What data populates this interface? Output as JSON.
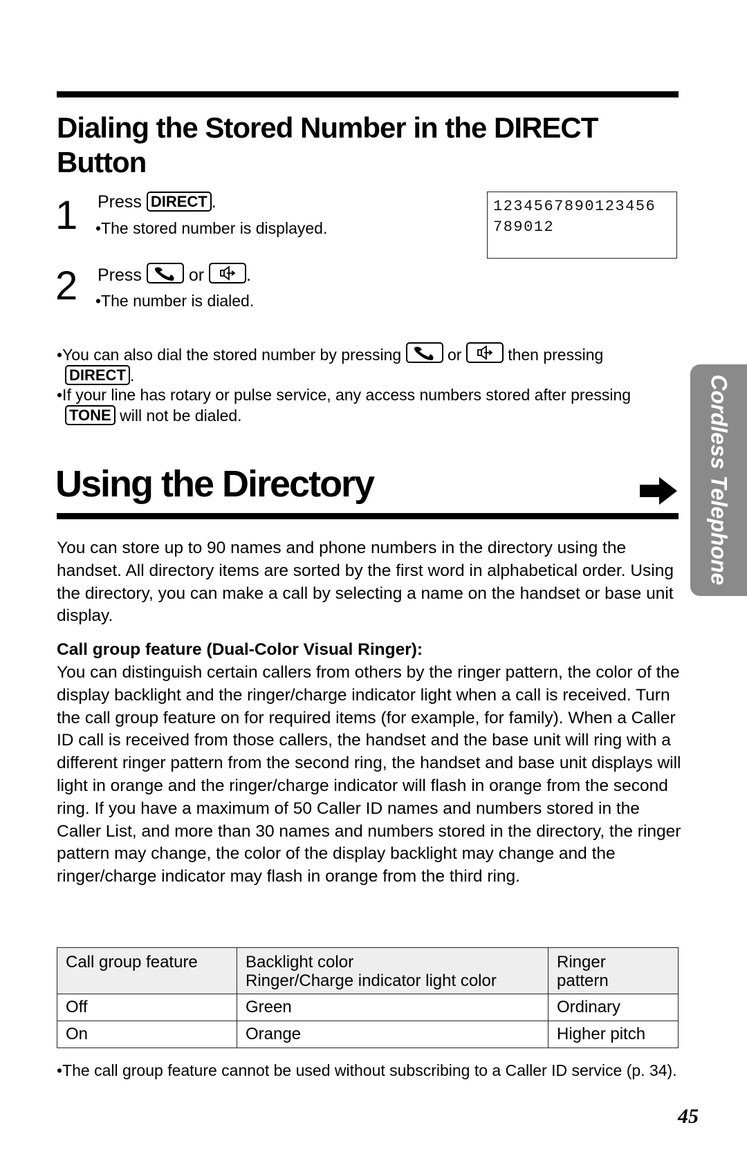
{
  "section1": {
    "title": "Dialing the Stored Number in the DIRECT Button",
    "steps": [
      {
        "number": "1",
        "press_label": "Press",
        "key": "DIRECT",
        "after": ".",
        "note": "•The stored number is displayed."
      },
      {
        "number": "2",
        "press_label": "Press",
        "icon_key_1": "talk-phone-handset",
        "or_label": "or",
        "icon_key_2": "speakerphone",
        "after": ".",
        "note": "•The number is dialed."
      }
    ],
    "display": {
      "line1": "1234567890123456",
      "line2": "789012"
    },
    "notes": [
      {
        "part1": "•You can also dial the stored number by pressing",
        "or_label": "or",
        "part2": "then pressing",
        "key": "DIRECT",
        "end": "."
      },
      {
        "part1": "•If your line has rotary or pulse service, any access numbers stored after pressing",
        "key": "TONE",
        "part2": "will not be dialed."
      }
    ]
  },
  "section2": {
    "title": "Using the Directory",
    "continue_icon": "arrow-right",
    "intro": "You can store up to 90 names and phone numbers in the directory using the handset. All directory items are sorted by the first word in alphabetical order. Using the directory, you can make a call by selecting a name on the handset or base unit display.",
    "call_group_heading": "Call group feature (Dual-Color Visual Ringer):",
    "call_group_text": "You can distinguish certain callers from others by the ringer pattern, the color of the display backlight and the ringer/charge indicator light when a call is received. Turn the call group feature on for required items (for example, for family). When a Caller ID call is received from those callers, the handset and the base unit will ring with a different ringer pattern from the second ring, the handset and base unit displays will light in orange and the ringer/charge indicator will flash in orange from the second ring. If you have a maximum of 50 Caller ID names and numbers stored in the Caller List, and more than 30 names and numbers stored in the directory, the ringer pattern may change, the color of the display backlight may change and the ringer/charge indicator may flash in orange from the third ring.",
    "table": {
      "headers": [
        "Call group feature",
        "Backlight color\nRinger/Charge indicator light color",
        "Ringer\npattern"
      ],
      "header_col2_line1": "Backlight color",
      "header_col2_line2": "Ringer/Charge indicator light color",
      "header_col3_line1": "Ringer",
      "header_col3_line2": "pattern",
      "rows": [
        [
          "Off",
          "Green",
          "Ordinary"
        ],
        [
          "On",
          "Orange",
          "Higher pitch"
        ]
      ]
    },
    "footnote": "•The call group feature cannot be used without subscribing to a Caller ID service (p. 34)."
  },
  "side_tab": "Cordless Telephone",
  "page_number": "45",
  "colors": {
    "side_tab_bg": "#8a8a8a",
    "table_header_bg": "#eeeeee"
  }
}
